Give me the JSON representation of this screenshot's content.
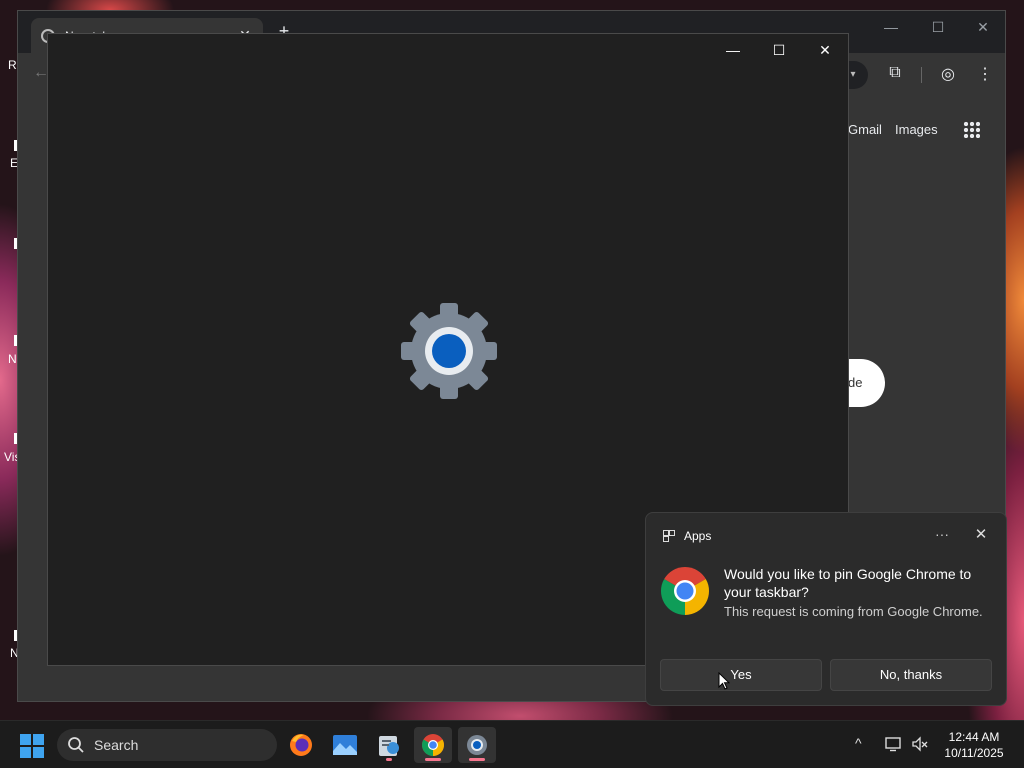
{
  "desktop": {
    "fragments": [
      "Re",
      "E",
      "N",
      "Vis",
      "N"
    ]
  },
  "chrome": {
    "tab_title": "New tab",
    "tab_close": "✕",
    "new_tab": "+",
    "window_minimize": "—",
    "window_maximize": "☐",
    "window_close": "✕",
    "back": "←",
    "omnibox_stub": "▾",
    "tab_search": "⧉",
    "profile": "◎",
    "menu": "⋮",
    "ntp_links": [
      "Gmail",
      "Images"
    ],
    "search_fragment": "de"
  },
  "settings_window": {
    "minimize": "—",
    "maximize": "☐",
    "close": "✕",
    "gear_color": "#7c8896",
    "gear_center": "#0a5fbf"
  },
  "toast": {
    "app_name": "Apps",
    "more": "···",
    "close": "✕",
    "title": "Would you like to pin Google Chrome to your taskbar?",
    "body": "This request is coming from Google Chrome.",
    "yes": "Yes",
    "no": "No, thanks"
  },
  "taskbar": {
    "search_placeholder": "Search",
    "apps": [
      "firefox-icon",
      "photos-icon",
      "app-icon",
      "chrome-icon",
      "settings-icon"
    ],
    "tray_chevron": "^",
    "time": "12:44 AM",
    "date": "10/11/2025"
  }
}
